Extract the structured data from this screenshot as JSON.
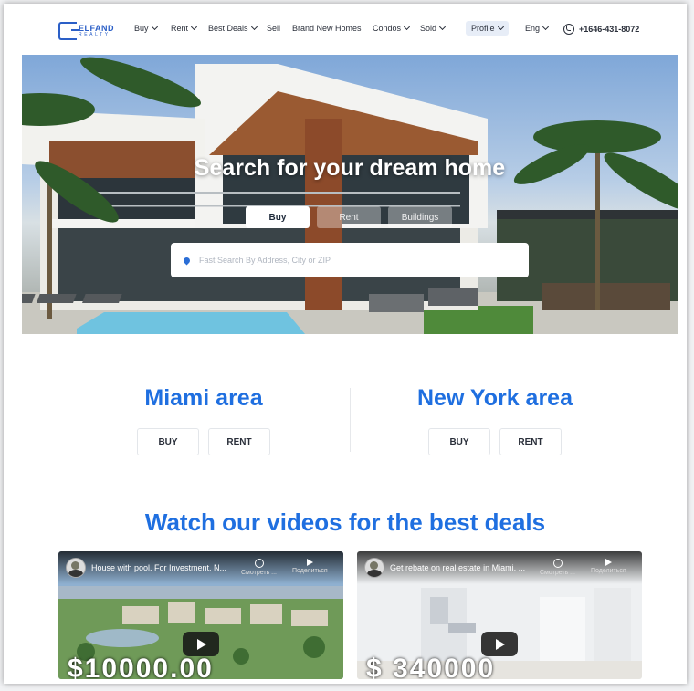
{
  "brand": {
    "logo_line1": "ELFAND",
    "logo_line2": "REALTY",
    "accent": "#1f6fe0"
  },
  "nav": {
    "items": [
      {
        "label": "Buy",
        "has_menu": true
      },
      {
        "label": "Rent",
        "has_menu": true
      },
      {
        "label": "Best Deals",
        "has_menu": true
      },
      {
        "label": "Sell",
        "has_menu": false
      },
      {
        "label": "Brand New Homes",
        "has_menu": false
      },
      {
        "label": "Condos",
        "has_menu": true
      },
      {
        "label": "Sold",
        "has_menu": true
      }
    ],
    "profile": "Profile",
    "language": "Eng",
    "phone": "+1646-431-8072"
  },
  "hero": {
    "title": "Search for your dream home",
    "tabs": [
      {
        "label": "Buy",
        "active": true
      },
      {
        "label": "Rent",
        "active": false
      },
      {
        "label": "Buildings",
        "active": false
      }
    ],
    "search_placeholder": "Fast Search By Address, City or ZIP"
  },
  "areas": [
    {
      "title": "Miami area",
      "buttons": [
        "BUY",
        "RENT"
      ]
    },
    {
      "title": "New York area",
      "buttons": [
        "BUY",
        "RENT"
      ]
    }
  ],
  "videos": {
    "title": "Watch our videos for the best deals",
    "items": [
      {
        "title": "House with pool. For Investment. N...",
        "watch_later": "Смотреть ...",
        "share": "Поделиться",
        "price_overlay": "$10000.00"
      },
      {
        "title": "Get rebate on real estate in Miami. ...",
        "watch_later": "Смотреть ...",
        "share": "Поделиться",
        "price_overlay": "$ 340000"
      }
    ]
  }
}
